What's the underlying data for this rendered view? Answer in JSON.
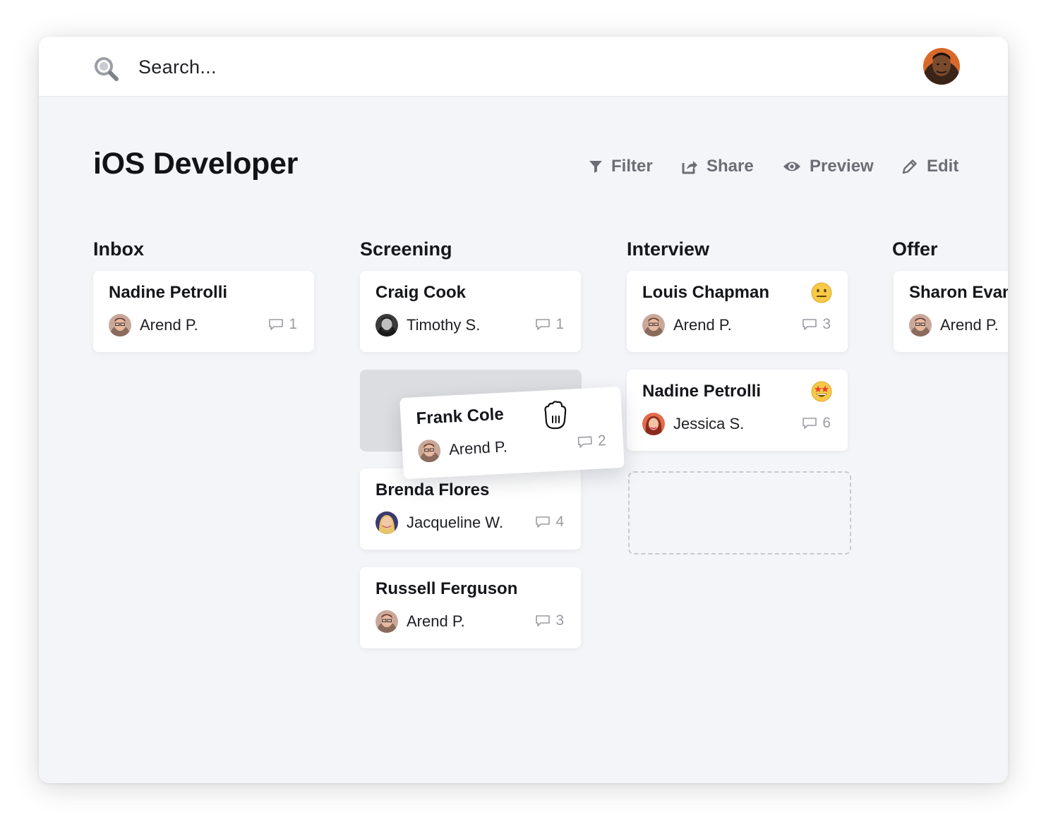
{
  "search": {
    "placeholder": "Search..."
  },
  "page": {
    "title": "iOS Developer"
  },
  "actions": {
    "filter": "Filter",
    "share": "Share",
    "preview": "Preview",
    "edit": "Edit"
  },
  "columns": {
    "inbox": {
      "title": "Inbox",
      "cards": [
        {
          "name": "Nadine Petrolli",
          "person": "Arend P.",
          "comments": "1"
        }
      ]
    },
    "screening": {
      "title": "Screening",
      "cards": [
        {
          "name": "Craig Cook",
          "person": "Timothy S.",
          "comments": "1"
        },
        {
          "name": "Brenda Flores",
          "person": "Jacqueline W.",
          "comments": "4"
        },
        {
          "name": "Russell Ferguson",
          "person": "Arend P.",
          "comments": "3"
        }
      ],
      "dragging": {
        "name": "Frank Cole",
        "person": "Arend P.",
        "comments": "2"
      }
    },
    "interview": {
      "title": "Interview",
      "cards": [
        {
          "name": "Louis Chapman",
          "person": "Arend P.",
          "comments": "3",
          "emoji": "neutral-face-emoji"
        },
        {
          "name": "Nadine Petrolli",
          "person": "Jessica S.",
          "comments": "6",
          "emoji": "star-struck-emoji"
        }
      ]
    },
    "offer": {
      "title": "Offer",
      "cards": [
        {
          "name": "Sharon Evans",
          "person": "Arend P."
        }
      ]
    }
  },
  "colors": {
    "background": "#f4f5f9",
    "card": "#ffffff",
    "action_text": "#6b6e75",
    "muted": "#9a9ca2",
    "emoji_yellow": "#f7c948"
  }
}
